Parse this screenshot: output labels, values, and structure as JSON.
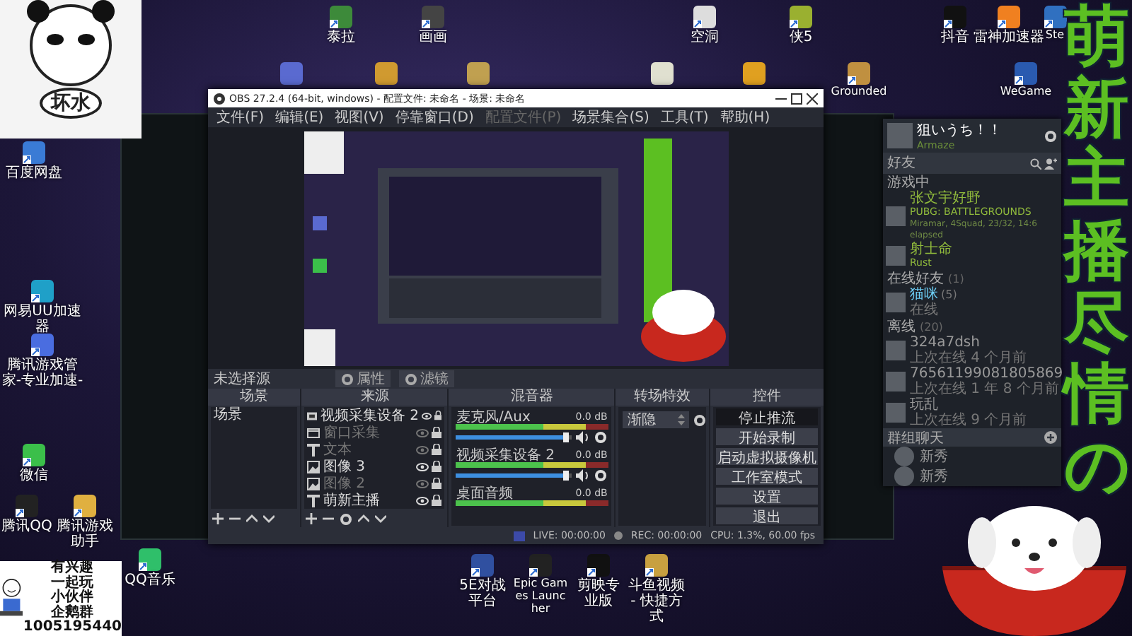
{
  "desktop_icons": [
    {
      "label": "百度网盘"
    },
    {
      "label": "网易UU加速器"
    },
    {
      "label": "腾讯游戏管家-专业加速-"
    },
    {
      "label": "微信"
    },
    {
      "label": "腾讯QQ"
    },
    {
      "label": "腾讯游戏助手"
    },
    {
      "label": "QQ音乐"
    },
    {
      "label": "泰拉"
    },
    {
      "label": "画画"
    },
    {
      "label": "空洞"
    },
    {
      "label": "侠5"
    },
    {
      "label": "抖音"
    },
    {
      "label": "雷神加速器"
    },
    {
      "label": "Ste"
    },
    {
      "label": "Grounded"
    },
    {
      "label": "WeGame"
    },
    {
      "label": "5E对战平台"
    },
    {
      "label": "Epic Games Launcher"
    },
    {
      "label": "剪映专业版"
    },
    {
      "label": "斗鱼视频 - 快捷方式"
    }
  ],
  "obs_window": {
    "title": "OBS 27.2.4 (64-bit, windows) - 配置文件: 未命名 - 场景: 未命名",
    "menu": [
      {
        "label": "文件(F)",
        "disabled": false
      },
      {
        "label": "编辑(E)",
        "disabled": false
      },
      {
        "label": "视图(V)",
        "disabled": false
      },
      {
        "label": "停靠窗口(D)",
        "disabled": false
      },
      {
        "label": "配置文件(P)",
        "disabled": true
      },
      {
        "label": "场景集合(S)",
        "disabled": false
      },
      {
        "label": "工具(T)",
        "disabled": false
      },
      {
        "label": "帮助(H)",
        "disabled": false
      }
    ],
    "source_bar": {
      "label": "未选择源",
      "buttons": [
        "属性",
        "滤镜"
      ]
    },
    "scenes": {
      "title": "场景",
      "items": [
        {
          "label": "场景"
        }
      ]
    },
    "sources": {
      "title": "来源",
      "items": [
        {
          "kind": "camera",
          "label": "视频采集设备 2",
          "visible": true
        },
        {
          "kind": "window",
          "label": "窗口采集",
          "visible": false
        },
        {
          "kind": "text",
          "label": "文本",
          "visible": false
        },
        {
          "kind": "image",
          "label": "图像 3",
          "visible": true
        },
        {
          "kind": "image",
          "label": "图像 2",
          "visible": false
        },
        {
          "kind": "text",
          "label": "萌新主播",
          "visible": true
        }
      ]
    },
    "mixer": {
      "title": "混音器",
      "channels": [
        {
          "name": "麦克风/Aux",
          "reading": "0.0 dB",
          "level": 0.95
        },
        {
          "name": "视频采集设备 2",
          "reading": "0.0 dB",
          "level": 0.95
        },
        {
          "name": "桌面音频",
          "reading": "0.0 dB"
        }
      ]
    },
    "transitions": {
      "title": "转场特效",
      "value": "渐隐"
    },
    "controls": {
      "title": "控件",
      "buttons": [
        {
          "label": "停止推流",
          "active": true
        },
        {
          "label": "开始录制",
          "active": false
        },
        {
          "label": "启动虚拟摄像机",
          "active": false
        },
        {
          "label": "工作室模式",
          "active": false
        },
        {
          "label": "设置",
          "active": false
        },
        {
          "label": "退出",
          "active": false
        }
      ]
    },
    "status_bar": [
      {
        "kind": "live",
        "text": "LIVE: 00:00:00"
      },
      {
        "kind": "rec",
        "text": "REC: 00:00:00"
      },
      {
        "kind": "perf",
        "text": "CPU: 1.3%, 60.00 fps"
      }
    ]
  },
  "steam_friends": {
    "user": {
      "name": "狙いうち！！",
      "status": "Armaze"
    },
    "search": {
      "placeholder": "好友"
    },
    "sections": [
      {
        "kind": "ingame",
        "title": "游戏中",
        "friends": [
          {
            "name": "张文宇好野",
            "game": "PUBG: BATTLEGROUNDS",
            "details": "Miramar, 4Squad, 23/32, 14:6 elapsed"
          },
          {
            "name": "射士命",
            "game": "Rust"
          }
        ]
      },
      {
        "kind": "online",
        "title": "在线好友",
        "count": "(1)",
        "friends": [
          {
            "name": "猫咪",
            "tag": "(5)",
            "status": "在线"
          }
        ]
      },
      {
        "kind": "offline",
        "title": "离线",
        "count": "(20)",
        "friends": [
          {
            "name": "324a7dsh",
            "status": "上次在线 4 个月前"
          },
          {
            "name": "76561199081805869",
            "status": "上次在线 1 年 8 个月前"
          },
          {
            "name": "玩乱",
            "status": "上次在线 9 个月前"
          }
        ]
      }
    ],
    "group_chats": {
      "title": "群组聊天",
      "groups": [
        {
          "name": "新秀"
        },
        {
          "name": "新秀"
        }
      ]
    }
  },
  "overlays": {
    "sticker_caption": "坏水",
    "invite_lines": [
      "有兴趣",
      "一起玩",
      "小伙伴",
      "企鹅群",
      "1005195440"
    ],
    "stream_title": "萌新主播尽情の"
  }
}
